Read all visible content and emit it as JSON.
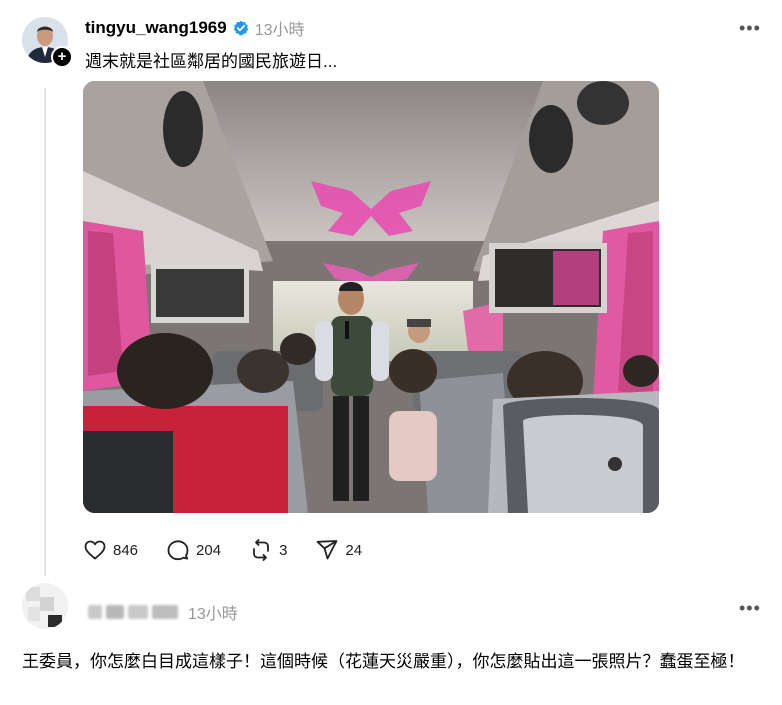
{
  "post": {
    "username": "tingyu_wang1969",
    "verified": true,
    "time": "13小時",
    "text": "週末就是社區鄰居的國民旅遊日...",
    "more_icon": "more-horizontal-icon",
    "media_alt": "bus interior photo"
  },
  "actions": {
    "like_count": "846",
    "comment_count": "204",
    "repost_count": "3",
    "share_count": "24"
  },
  "reply": {
    "time": "13小時",
    "text": "王委員，你怎麼白目成這樣子！這個時候（花蓮天災嚴重），你怎麼貼出這一張照片？蠢蛋至極！"
  },
  "colors": {
    "verified_blue": "#1d9bf0",
    "meta_gray": "#999999",
    "thread_line": "#e3e3e3"
  }
}
